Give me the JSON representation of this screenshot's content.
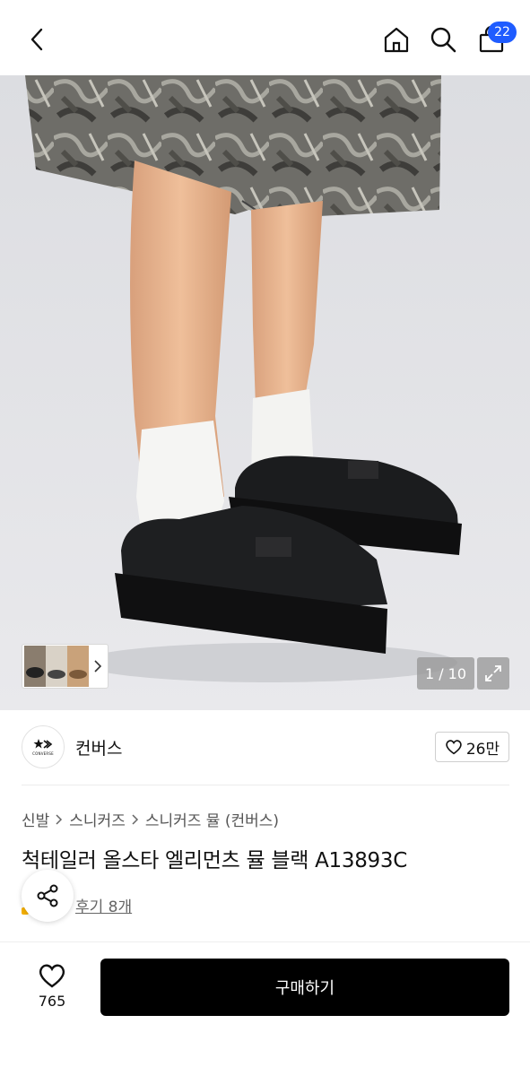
{
  "header": {
    "cart_badge": "22",
    "icons": [
      "back-arrow-icon",
      "home-icon",
      "search-icon",
      "shopping-bag-icon"
    ]
  },
  "gallery": {
    "counter": "1 / 10",
    "thumbnail_arrow": "chevron-right-icon",
    "expand_icon": "expand-icon"
  },
  "brand": {
    "name": "컨버스",
    "logo_text": "CONVERSE",
    "like_count": "26만"
  },
  "breadcrumb": [
    "신발",
    "스니커즈",
    "스니커즈 뮬 (컨버스)"
  ],
  "product": {
    "title": "척테일러 올스타 엘리먼츠 뮬 블랙 A13893C",
    "review_link": "후기 8개"
  },
  "bottom_bar": {
    "wish_count": "765",
    "buy_label": "구매하기"
  },
  "colors": {
    "badge": "#1f5cff",
    "buy_button": "#000000",
    "hero_background": "#e4e5e9"
  }
}
